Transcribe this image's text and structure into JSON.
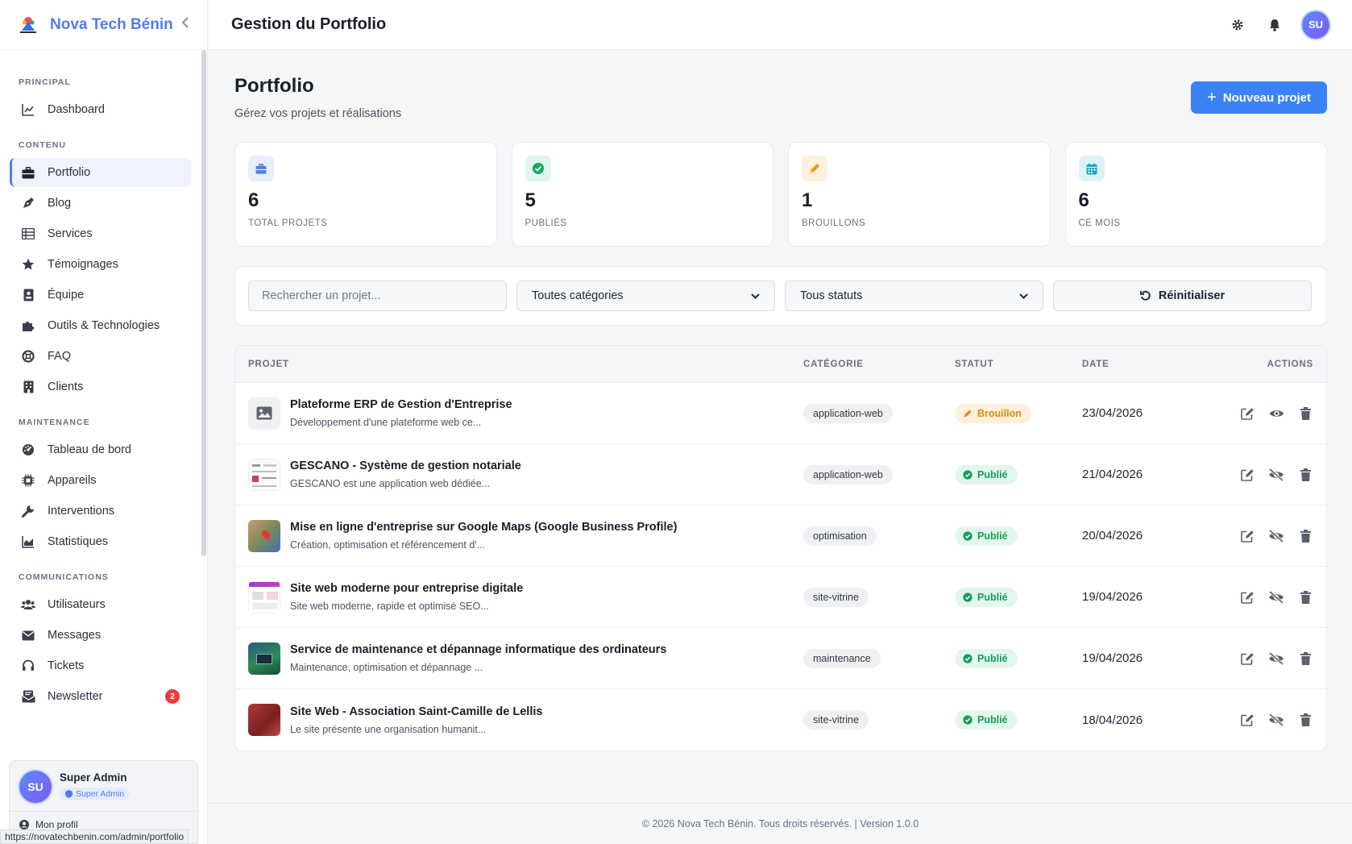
{
  "brand": {
    "name": "Nova Tech Bénin"
  },
  "sidebar": {
    "sections": [
      {
        "title": "PRINCIPAL",
        "items": [
          {
            "label": "Dashboard",
            "icon": "chart-line-icon"
          }
        ]
      },
      {
        "title": "CONTENU",
        "items": [
          {
            "label": "Portfolio",
            "icon": "briefcase-icon",
            "active": true
          },
          {
            "label": "Blog",
            "icon": "pen-nib-icon"
          },
          {
            "label": "Services",
            "icon": "list-icon"
          },
          {
            "label": "Témoignages",
            "icon": "star-icon"
          },
          {
            "label": "Équipe",
            "icon": "id-badge-icon"
          },
          {
            "label": "Outils & Technologies",
            "icon": "puzzle-icon"
          },
          {
            "label": "FAQ",
            "icon": "life-ring-icon"
          },
          {
            "label": "Clients",
            "icon": "building-icon"
          }
        ]
      },
      {
        "title": "MAINTENANCE",
        "items": [
          {
            "label": "Tableau de bord",
            "icon": "gauge-icon"
          },
          {
            "label": "Appareils",
            "icon": "chip-icon"
          },
          {
            "label": "Interventions",
            "icon": "wrench-icon"
          },
          {
            "label": "Statistiques",
            "icon": "chart-area-icon"
          }
        ]
      },
      {
        "title": "COMMUNICATIONS",
        "items": [
          {
            "label": "Utilisateurs",
            "icon": "users-icon"
          },
          {
            "label": "Messages",
            "icon": "envelope-icon"
          },
          {
            "label": "Tickets",
            "icon": "headset-icon"
          },
          {
            "label": "Newsletter",
            "icon": "newsletter-icon",
            "badge": "2"
          }
        ]
      }
    ],
    "user": {
      "initials": "SU",
      "name": "Super Admin",
      "role": "Super Admin",
      "profile_link": "Mon profil"
    },
    "status_url": "https://novatechbenin.com/admin/portfolio"
  },
  "header": {
    "title": "Gestion du Portfolio",
    "avatar_initials": "SU"
  },
  "page": {
    "title": "Portfolio",
    "subtitle": "Gérez vos projets et réalisations",
    "new_button": "Nouveau projet"
  },
  "stats": [
    {
      "value": "6",
      "label": "TOTAL PROJETS",
      "color": "#4f7cf0",
      "bg": "#e8eefc",
      "icon": "briefcase-icon"
    },
    {
      "value": "5",
      "label": "PUBLIÉS",
      "color": "#1aa863",
      "bg": "#e2f5ea",
      "icon": "check-circle-icon"
    },
    {
      "value": "1",
      "label": "BROUILLONS",
      "color": "#f29a0e",
      "bg": "#fdf0dc",
      "icon": "pencil-icon"
    },
    {
      "value": "6",
      "label": "CE MOIS",
      "color": "#17a7c4",
      "bg": "#def3f7",
      "icon": "calendar-icon"
    }
  ],
  "filters": {
    "search_placeholder": "Rechercher un projet...",
    "category_value": "Toutes catégories",
    "status_value": "Tous statuts",
    "reset_label": "Réinitialiser"
  },
  "table": {
    "headers": {
      "project": "PROJET",
      "category": "CATÉGORIE",
      "status": "STATUT",
      "date": "DATE",
      "actions": "ACTIONS"
    },
    "rows": [
      {
        "title": "Plateforme ERP de Gestion d'Entreprise",
        "desc": "Développement d'une plateforme web ce...",
        "category": "application-web",
        "status": "Brouillon",
        "status_type": "draft",
        "date": "23/04/2026",
        "visible_icon": "eye-icon"
      },
      {
        "title": "GESCANO - Système de gestion notariale",
        "desc": "GESCANO est une application web dédiée...",
        "category": "application-web",
        "status": "Publié",
        "status_type": "pub",
        "date": "21/04/2026",
        "visible_icon": "eye-slash-icon"
      },
      {
        "title": "Mise en ligne d'entreprise sur Google Maps (Google Business Profile)",
        "desc": "Création, optimisation et référencement d'...",
        "category": "optimisation",
        "status": "Publié",
        "status_type": "pub",
        "date": "20/04/2026",
        "visible_icon": "eye-slash-icon"
      },
      {
        "title": "Site web moderne pour entreprise digitale",
        "desc": "Site web moderne, rapide et optimisé SEO...",
        "category": "site-vitrine",
        "status": "Publié",
        "status_type": "pub",
        "date": "19/04/2026",
        "visible_icon": "eye-slash-icon"
      },
      {
        "title": "Service de maintenance et dépannage informatique des ordinateurs",
        "desc": "Maintenance, optimisation et dépannage ...",
        "category": "maintenance",
        "status": "Publié",
        "status_type": "pub",
        "date": "19/04/2026",
        "visible_icon": "eye-slash-icon"
      },
      {
        "title": "Site Web - Association Saint-Camille de Lellis",
        "desc": "Le site présente une organisation humanit...",
        "category": "site-vitrine",
        "status": "Publié",
        "status_type": "pub",
        "date": "18/04/2026",
        "visible_icon": "eye-slash-icon"
      }
    ]
  },
  "footer": {
    "text": "© 2026 Nova Tech Bénin. Tous droits réservés. | Version 1.0.0"
  }
}
